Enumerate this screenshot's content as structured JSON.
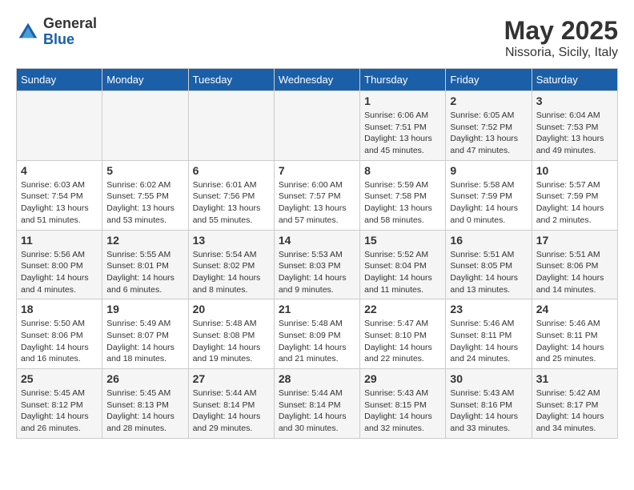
{
  "logo": {
    "general": "General",
    "blue": "Blue"
  },
  "title": "May 2025",
  "location": "Nissoria, Sicily, Italy",
  "weekdays": [
    "Sunday",
    "Monday",
    "Tuesday",
    "Wednesday",
    "Thursday",
    "Friday",
    "Saturday"
  ],
  "weeks": [
    [
      {
        "day": "",
        "info": ""
      },
      {
        "day": "",
        "info": ""
      },
      {
        "day": "",
        "info": ""
      },
      {
        "day": "",
        "info": ""
      },
      {
        "day": "1",
        "info": "Sunrise: 6:06 AM\nSunset: 7:51 PM\nDaylight: 13 hours\nand 45 minutes."
      },
      {
        "day": "2",
        "info": "Sunrise: 6:05 AM\nSunset: 7:52 PM\nDaylight: 13 hours\nand 47 minutes."
      },
      {
        "day": "3",
        "info": "Sunrise: 6:04 AM\nSunset: 7:53 PM\nDaylight: 13 hours\nand 49 minutes."
      }
    ],
    [
      {
        "day": "4",
        "info": "Sunrise: 6:03 AM\nSunset: 7:54 PM\nDaylight: 13 hours\nand 51 minutes."
      },
      {
        "day": "5",
        "info": "Sunrise: 6:02 AM\nSunset: 7:55 PM\nDaylight: 13 hours\nand 53 minutes."
      },
      {
        "day": "6",
        "info": "Sunrise: 6:01 AM\nSunset: 7:56 PM\nDaylight: 13 hours\nand 55 minutes."
      },
      {
        "day": "7",
        "info": "Sunrise: 6:00 AM\nSunset: 7:57 PM\nDaylight: 13 hours\nand 57 minutes."
      },
      {
        "day": "8",
        "info": "Sunrise: 5:59 AM\nSunset: 7:58 PM\nDaylight: 13 hours\nand 58 minutes."
      },
      {
        "day": "9",
        "info": "Sunrise: 5:58 AM\nSunset: 7:59 PM\nDaylight: 14 hours\nand 0 minutes."
      },
      {
        "day": "10",
        "info": "Sunrise: 5:57 AM\nSunset: 7:59 PM\nDaylight: 14 hours\nand 2 minutes."
      }
    ],
    [
      {
        "day": "11",
        "info": "Sunrise: 5:56 AM\nSunset: 8:00 PM\nDaylight: 14 hours\nand 4 minutes."
      },
      {
        "day": "12",
        "info": "Sunrise: 5:55 AM\nSunset: 8:01 PM\nDaylight: 14 hours\nand 6 minutes."
      },
      {
        "day": "13",
        "info": "Sunrise: 5:54 AM\nSunset: 8:02 PM\nDaylight: 14 hours\nand 8 minutes."
      },
      {
        "day": "14",
        "info": "Sunrise: 5:53 AM\nSunset: 8:03 PM\nDaylight: 14 hours\nand 9 minutes."
      },
      {
        "day": "15",
        "info": "Sunrise: 5:52 AM\nSunset: 8:04 PM\nDaylight: 14 hours\nand 11 minutes."
      },
      {
        "day": "16",
        "info": "Sunrise: 5:51 AM\nSunset: 8:05 PM\nDaylight: 14 hours\nand 13 minutes."
      },
      {
        "day": "17",
        "info": "Sunrise: 5:51 AM\nSunset: 8:06 PM\nDaylight: 14 hours\nand 14 minutes."
      }
    ],
    [
      {
        "day": "18",
        "info": "Sunrise: 5:50 AM\nSunset: 8:06 PM\nDaylight: 14 hours\nand 16 minutes."
      },
      {
        "day": "19",
        "info": "Sunrise: 5:49 AM\nSunset: 8:07 PM\nDaylight: 14 hours\nand 18 minutes."
      },
      {
        "day": "20",
        "info": "Sunrise: 5:48 AM\nSunset: 8:08 PM\nDaylight: 14 hours\nand 19 minutes."
      },
      {
        "day": "21",
        "info": "Sunrise: 5:48 AM\nSunset: 8:09 PM\nDaylight: 14 hours\nand 21 minutes."
      },
      {
        "day": "22",
        "info": "Sunrise: 5:47 AM\nSunset: 8:10 PM\nDaylight: 14 hours\nand 22 minutes."
      },
      {
        "day": "23",
        "info": "Sunrise: 5:46 AM\nSunset: 8:11 PM\nDaylight: 14 hours\nand 24 minutes."
      },
      {
        "day": "24",
        "info": "Sunrise: 5:46 AM\nSunset: 8:11 PM\nDaylight: 14 hours\nand 25 minutes."
      }
    ],
    [
      {
        "day": "25",
        "info": "Sunrise: 5:45 AM\nSunset: 8:12 PM\nDaylight: 14 hours\nand 26 minutes."
      },
      {
        "day": "26",
        "info": "Sunrise: 5:45 AM\nSunset: 8:13 PM\nDaylight: 14 hours\nand 28 minutes."
      },
      {
        "day": "27",
        "info": "Sunrise: 5:44 AM\nSunset: 8:14 PM\nDaylight: 14 hours\nand 29 minutes."
      },
      {
        "day": "28",
        "info": "Sunrise: 5:44 AM\nSunset: 8:14 PM\nDaylight: 14 hours\nand 30 minutes."
      },
      {
        "day": "29",
        "info": "Sunrise: 5:43 AM\nSunset: 8:15 PM\nDaylight: 14 hours\nand 32 minutes."
      },
      {
        "day": "30",
        "info": "Sunrise: 5:43 AM\nSunset: 8:16 PM\nDaylight: 14 hours\nand 33 minutes."
      },
      {
        "day": "31",
        "info": "Sunrise: 5:42 AM\nSunset: 8:17 PM\nDaylight: 14 hours\nand 34 minutes."
      }
    ]
  ]
}
